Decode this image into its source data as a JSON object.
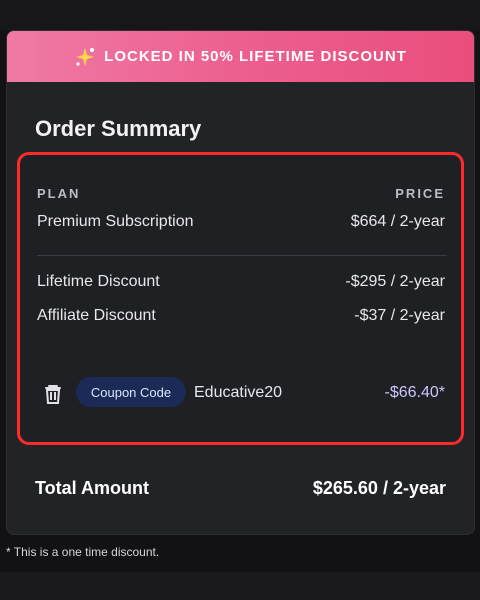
{
  "banner": {
    "text": "LOCKED IN 50% LIFETIME DISCOUNT"
  },
  "order": {
    "title": "Order Summary",
    "header": {
      "plan_label": "PLAN",
      "price_label": "PRICE"
    },
    "items": [
      {
        "label": "Premium Subscription",
        "price": "$664 / 2-year"
      },
      {
        "label": "Lifetime Discount",
        "price": "-$295 / 2-year"
      },
      {
        "label": "Affiliate Discount",
        "price": "-$37 / 2-year"
      }
    ],
    "coupon": {
      "badge": "Coupon Code",
      "code": "Educative20",
      "amount": "-$66.40*"
    }
  },
  "total": {
    "label": "Total Amount",
    "value": "$265.60 / 2-year"
  },
  "footnote": "* This is a one time discount.",
  "colors": {
    "banner_start": "#f07aa5",
    "banner_end": "#e94e7c",
    "highlight": "#ff2b2b",
    "coupon_bg": "#1b2a56"
  },
  "icons": {
    "banner": "sparkle-icon",
    "remove": "trash-icon"
  }
}
